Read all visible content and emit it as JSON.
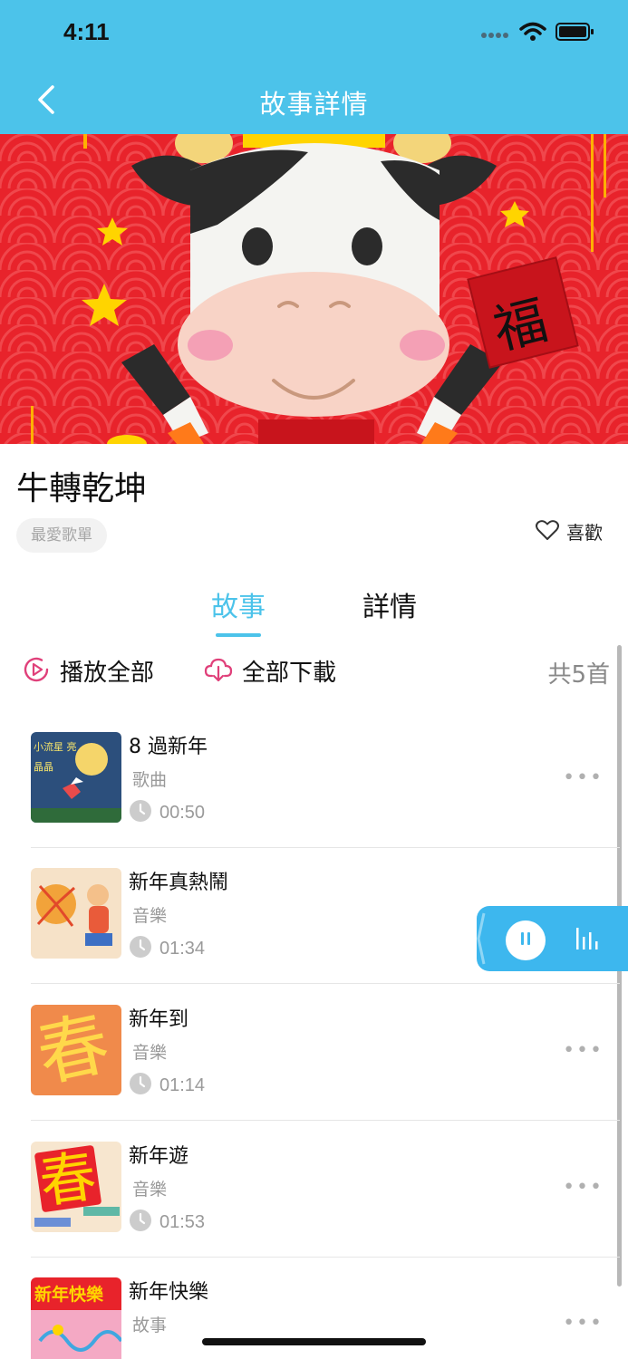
{
  "status_bar": {
    "time": "4:11"
  },
  "nav": {
    "title": "故事詳情"
  },
  "hero": {
    "seal_char": "福"
  },
  "story": {
    "title": "牛轉乾坤",
    "playlist_tag": "最愛歌單",
    "like_label": "喜歡"
  },
  "tabs": [
    {
      "label": "故事",
      "active": true
    },
    {
      "label": "詳情",
      "active": false
    }
  ],
  "actions": {
    "play_all": "播放全部",
    "download_all": "全部下載",
    "total": "共5首"
  },
  "tracks": [
    {
      "title": "8 過新年",
      "type": "歌曲",
      "duration": "00:50",
      "thumb_text": "小流星 亮晶晶"
    },
    {
      "title": "新年真熱鬧",
      "type": "音樂",
      "duration": "01:34"
    },
    {
      "title": "新年到",
      "type": "音樂",
      "duration": "01:14",
      "thumb_char": "春"
    },
    {
      "title": "新年遊",
      "type": "音樂",
      "duration": "01:53",
      "thumb_char": "春"
    },
    {
      "title": "新年快樂",
      "type": "故事",
      "thumb_text": "新年快樂"
    }
  ],
  "colors": {
    "accent": "#4cc3ea",
    "hero_red": "#e8232b",
    "player": "#3db7ee",
    "icon_pink": "#e0407a"
  }
}
